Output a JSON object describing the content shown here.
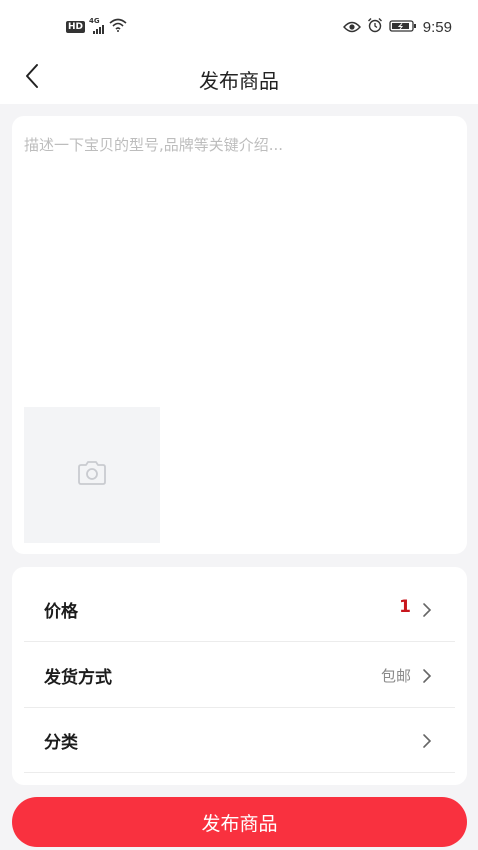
{
  "status_bar": {
    "hd_label": "HD",
    "network_label": "4G",
    "time": "9:59"
  },
  "header": {
    "title": "发布商品",
    "back_icon": "chevron-left-icon"
  },
  "description": {
    "placeholder": "描述一下宝贝的型号,品牌等关键介绍...",
    "value": "",
    "photo_icon": "camera-icon"
  },
  "options": [
    {
      "label": "价格",
      "value": "1",
      "value_color": "#c8161d"
    },
    {
      "label": "发货方式",
      "value": "包邮"
    },
    {
      "label": "分类",
      "value": ""
    }
  ],
  "publish_button": {
    "label": "发布商品",
    "color": "#f9313f"
  }
}
